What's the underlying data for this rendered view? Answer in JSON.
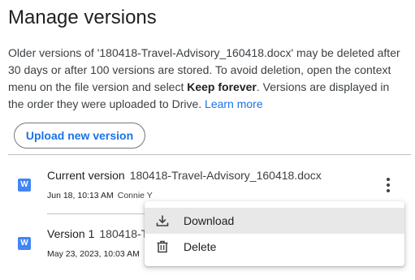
{
  "dialog": {
    "title": "Manage versions",
    "description": {
      "text_before": "Older versions of '180418-Travel-Advisory_160418.docx' may be deleted after 30 days or after 100 versions are stored. To avoid deletion, open the context menu on the file version and select ",
      "bold_text": "Keep forever",
      "text_after": ". Versions are displayed in the order they were uploaded to Drive. ",
      "link_text": "Learn more"
    },
    "upload_button_label": "Upload new version"
  },
  "versions": [
    {
      "label": "Current version",
      "file_name": "180418-Travel-Advisory_160418.docx",
      "date": "Jun 18, 10:13 AM",
      "author": "Connie Y",
      "icon_letter": "W"
    },
    {
      "label": "Version 1",
      "file_name": "180418-T",
      "date": "May 23, 2023, 10:03 AM",
      "author": "",
      "icon_letter": "W"
    }
  ],
  "context_menu": {
    "items": [
      {
        "label": "Download",
        "icon": "download-icon",
        "highlighted": true
      },
      {
        "label": "Delete",
        "icon": "trash-icon",
        "highlighted": false
      }
    ]
  },
  "colors": {
    "accent": "#1a73e8",
    "doc_icon": "#4285f4",
    "highlight": "#e8e8e8"
  }
}
